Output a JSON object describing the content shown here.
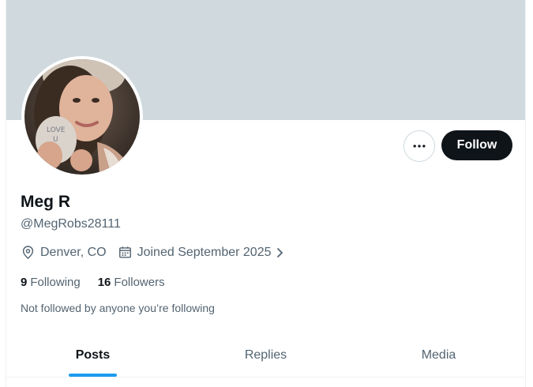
{
  "profile": {
    "name": "Meg R",
    "handle": "@MegRobs28111",
    "location": "Denver, CO",
    "joined": "Joined September 2025",
    "avatar_alt": "profile-photo"
  },
  "actions": {
    "follow_label": "Follow",
    "more_icon": "ellipsis-icon"
  },
  "stats": {
    "following_count": "9",
    "following_label": "Following",
    "followers_count": "16",
    "followers_label": "Followers"
  },
  "note": "Not followed by anyone you’re following",
  "tabs": [
    {
      "label": "Posts",
      "active": true
    },
    {
      "label": "Replies",
      "active": false
    },
    {
      "label": "Media",
      "active": false
    }
  ],
  "colors": {
    "banner": "#cfd9de",
    "accent": "#1d9bf0",
    "text_primary": "#0f1419",
    "text_secondary": "#536471"
  }
}
